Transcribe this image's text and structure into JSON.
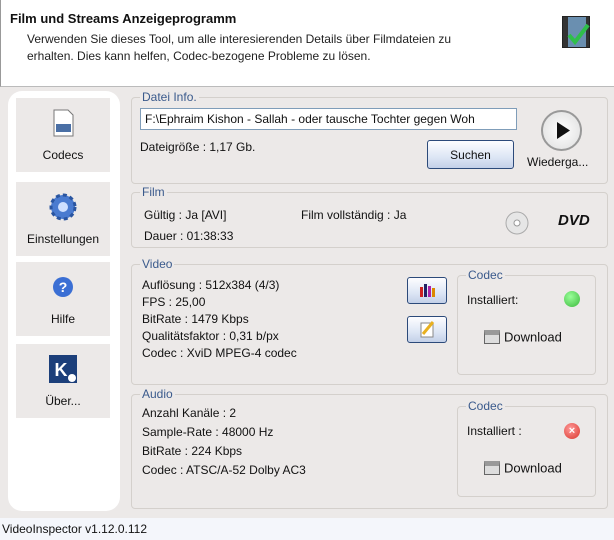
{
  "header": {
    "title": "Film und Streams Anzeigeprogramm",
    "description_line1": "Verwenden Sie dieses Tool, um alle interesierenden Details über Filmdateien zu",
    "description_line2": "erhalten. Dies kann helfen, Codec-bezogene Probleme zu lösen."
  },
  "sidebar": {
    "items": [
      {
        "label": "Codecs"
      },
      {
        "label": "Einstellungen"
      },
      {
        "label": "Hilfe"
      },
      {
        "label": "Über..."
      }
    ]
  },
  "file_info": {
    "title": "Datei Info.",
    "path": "F:\\Ephraim Kishon - Sallah - oder tausche Tochter gegen Woh",
    "size": "Dateigröße : 1,17 Gb.",
    "search_label": "Suchen",
    "play_label": "Wiederga..."
  },
  "film": {
    "title": "Film",
    "valid": "Gültig : Ja [AVI]",
    "complete": "Film vollständig : Ja",
    "duration": "Dauer : 01:38:33",
    "dvd_label": "DVD"
  },
  "video": {
    "title": "Video",
    "lines": [
      "Auflösung : 512x384 (4/3)",
      "FPS : 25,00",
      "BitRate : 1479 Kbps",
      "Qualitätsfaktor : 0,31 b/px",
      "Codec : XviD MPEG-4 codec"
    ],
    "codec_title": "Codec",
    "installed_label": "Installiert:",
    "download_label": "Download",
    "status_color": "#3cb83c"
  },
  "audio": {
    "title": "Audio",
    "lines": [
      "Anzahl Kanäle : 2",
      "Sample-Rate : 48000 Hz",
      "BitRate : 224 Kbps",
      "Codec : ATSC/A-52 Dolby AC3"
    ],
    "codec_title": "Codec",
    "installed_label": "Installiert :",
    "download_label": "Download",
    "status_color": "#d9362b"
  },
  "status_bar": {
    "version": "VideoInspector v1.12.0.112"
  }
}
